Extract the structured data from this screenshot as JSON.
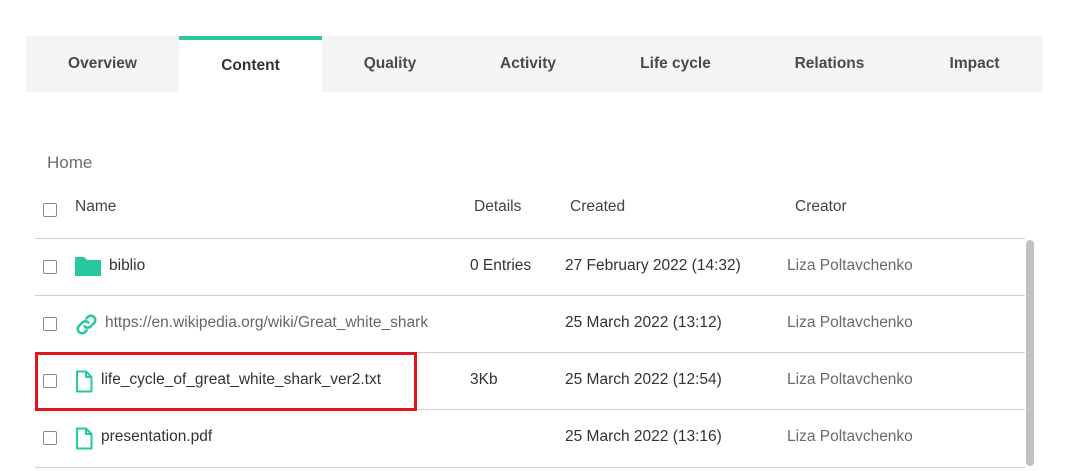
{
  "tabs": [
    {
      "label": "Overview",
      "active": false
    },
    {
      "label": "Content",
      "active": true
    },
    {
      "label": "Quality",
      "active": false
    },
    {
      "label": "Activity",
      "active": false
    },
    {
      "label": "Life cycle",
      "active": false
    },
    {
      "label": "Relations",
      "active": false
    },
    {
      "label": "Impact",
      "active": false
    }
  ],
  "breadcrumb": "Home",
  "table": {
    "headers": {
      "name": "Name",
      "details": "Details",
      "created": "Created",
      "creator": "Creator"
    },
    "rows": [
      {
        "icon": "folder-icon",
        "name": "biblio",
        "details": "0 Entries",
        "created": "27 February 2022 (14:32)",
        "creator": "Liza Poltavchenko"
      },
      {
        "icon": "link-icon",
        "name": "https://en.wikipedia.org/wiki/Great_white_shark",
        "details": "",
        "created": "25 March 2022 (13:12)",
        "creator": "Liza Poltavchenko"
      },
      {
        "icon": "file-icon",
        "name": "life_cycle_of_great_white_shark_ver2.txt",
        "details": "3Kb",
        "created": "25 March 2022 (12:54)",
        "creator": "Liza Poltavchenko"
      },
      {
        "icon": "file-icon",
        "name": "presentation.pdf",
        "details": "",
        "created": "25 March 2022 (13:16)",
        "creator": "Liza Poltavchenko"
      }
    ]
  },
  "colors": {
    "accent": "#26c9a0",
    "highlight": "#e0161e"
  }
}
